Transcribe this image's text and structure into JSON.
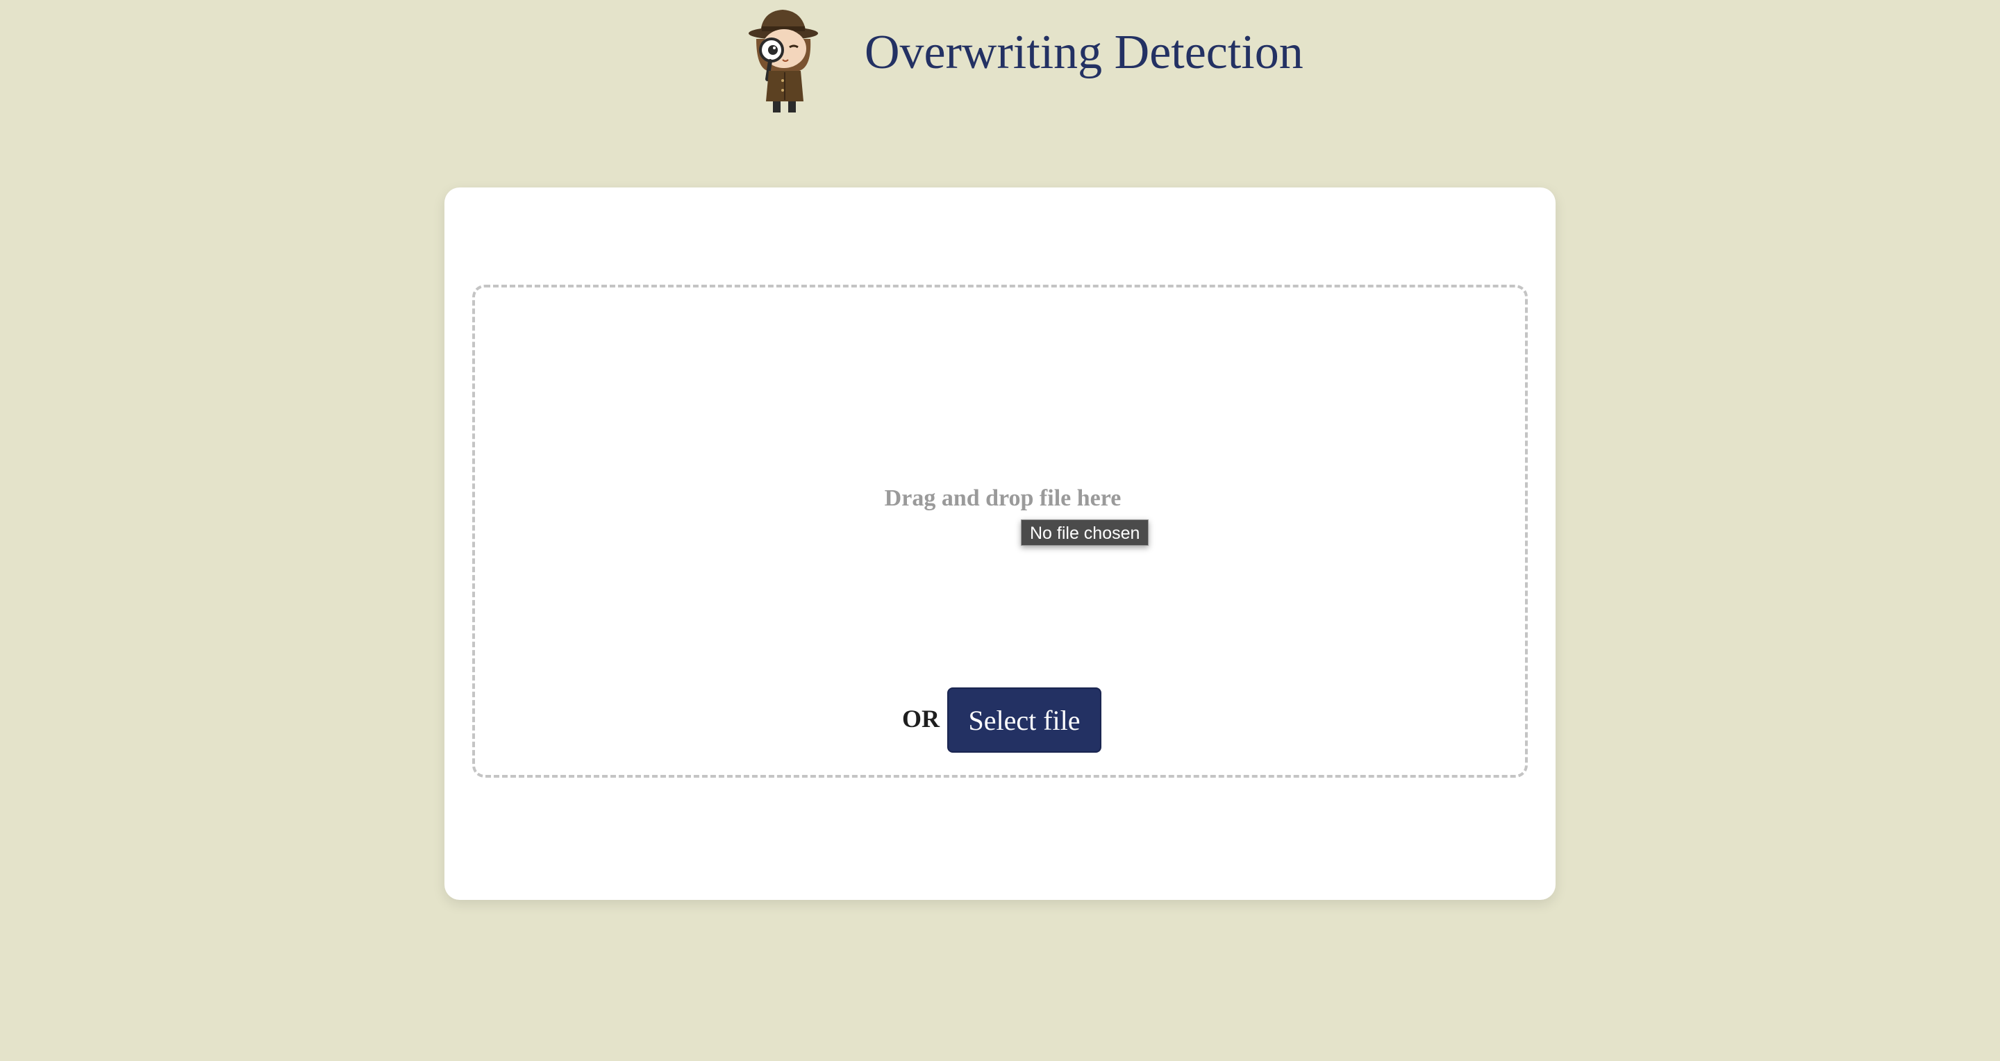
{
  "header": {
    "title": "Overwriting Detection",
    "logo_icon": "detective-mascot-icon"
  },
  "upload": {
    "drop_text": "Drag and drop file here",
    "tooltip_text": "No file chosen",
    "or_label": "OR",
    "select_button_label": "Select file"
  },
  "colors": {
    "background": "#e4e3ca",
    "title": "#233163",
    "button": "#233163",
    "card": "#ffffff",
    "drop_text": "#9a9a9a"
  }
}
